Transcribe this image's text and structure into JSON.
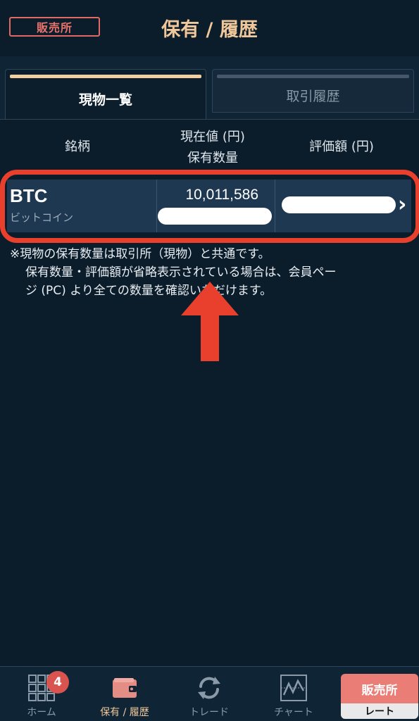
{
  "header": {
    "badge": "販売所",
    "title": "保有 / 履歴"
  },
  "tabs": [
    {
      "label": "現物一覧",
      "active": true
    },
    {
      "label": "取引履歴",
      "active": false
    }
  ],
  "columns": {
    "name": "銘柄",
    "price_line1": "現在値 (円)",
    "price_line2": "保有数量",
    "value": "評価額 (円)"
  },
  "holdings": [
    {
      "symbol": "BTC",
      "name": "ビットコイン",
      "price": "10,011,586"
    }
  ],
  "note": {
    "line1": "※現物の保有数量は取引所（現物）と共通です。",
    "line2": "保有数量・評価額が省略表示されている場合は、会員ペー",
    "line3": "ジ (PC) より全ての数量を確認いただけます。"
  },
  "nav": {
    "home": {
      "label": "ホーム",
      "badge": "4",
      "icon": "grid-icon"
    },
    "holdings": {
      "label": "保有 / 履歴",
      "icon": "wallet-icon"
    },
    "trade": {
      "label": "トレード",
      "icon": "refresh-icon"
    },
    "chart": {
      "label": "チャート",
      "icon": "chart-icon"
    },
    "rate": {
      "top": "販売所",
      "bottom": "レート"
    }
  },
  "colors": {
    "background": "#0b1c2a",
    "accent": "#f0c79a",
    "highlight": "#e8402c",
    "badge": "#d9534f"
  }
}
